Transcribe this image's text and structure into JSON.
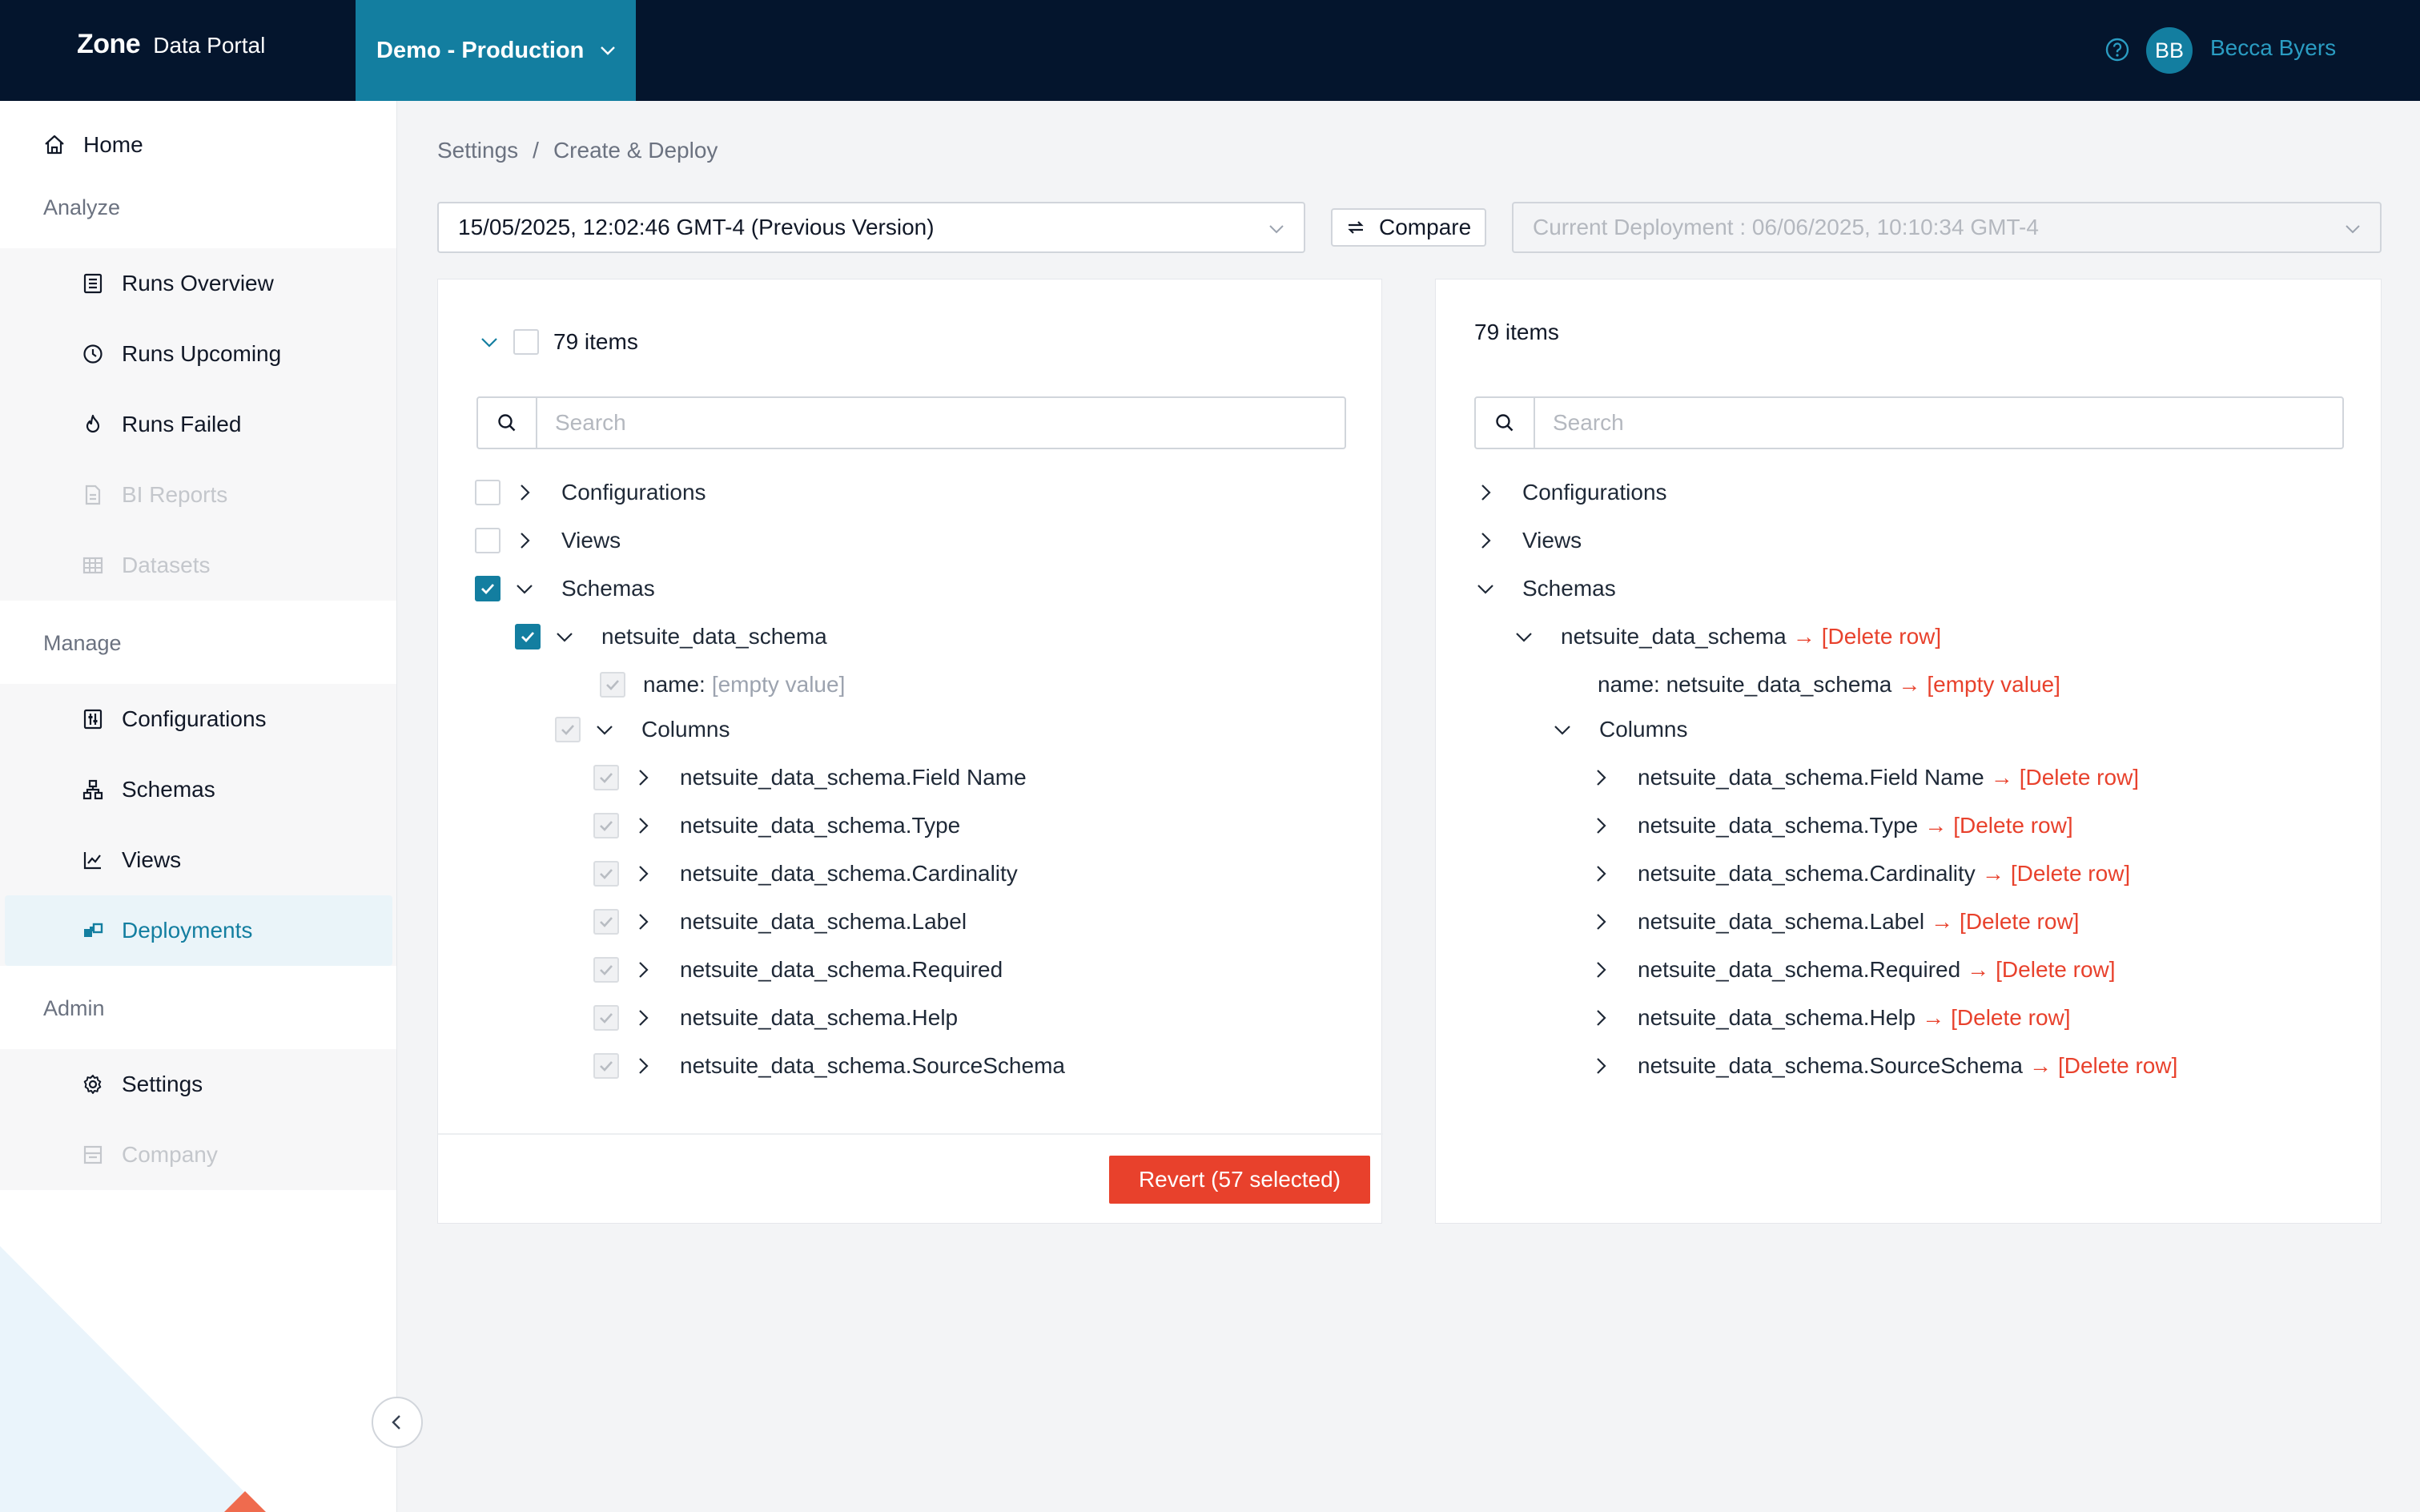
{
  "header": {
    "brand": "Zone",
    "product": "Data Portal",
    "environment": "Demo - Production",
    "user_initials": "BB",
    "user_name": "Becca Byers"
  },
  "sidebar": {
    "home": "Home",
    "sections": {
      "analyze": "Analyze",
      "manage": "Manage",
      "admin": "Admin"
    },
    "analyze_items": [
      "Runs Overview",
      "Runs Upcoming",
      "Runs Failed",
      "BI Reports",
      "Datasets"
    ],
    "manage_items": [
      "Configurations",
      "Schemas",
      "Views",
      "Deployments"
    ],
    "admin_items": [
      "Settings",
      "Company"
    ],
    "active": "Deployments"
  },
  "breadcrumb": {
    "parent": "Settings",
    "separator": "/",
    "current": "Create & Deploy"
  },
  "toolbar": {
    "version_value": "15/05/2025, 12:02:46 GMT-4 (Previous Version)",
    "compare_label": "Compare",
    "current_deployment": "Current Deployment : 06/06/2025, 10:10:34 GMT-4"
  },
  "left_panel": {
    "count_label": "79 items",
    "search_placeholder": "Search",
    "tree": {
      "configurations": "Configurations",
      "views": "Views",
      "schemas": "Schemas",
      "schema_name": "netsuite_data_schema",
      "name_key": "name:",
      "name_value": "[empty value]",
      "columns": "Columns",
      "column_items": [
        "netsuite_data_schema.Field Name",
        "netsuite_data_schema.Type",
        "netsuite_data_schema.Cardinality",
        "netsuite_data_schema.Label",
        "netsuite_data_schema.Required",
        "netsuite_data_schema.Help",
        "netsuite_data_schema.SourceSchema"
      ]
    },
    "revert_label": "Revert (57 selected)"
  },
  "right_panel": {
    "count_label": "79 items",
    "search_placeholder": "Search",
    "tree": {
      "configurations": "Configurations",
      "views": "Views",
      "schemas": "Schemas",
      "schema_name": "netsuite_data_schema",
      "schema_change": "[Delete row]",
      "name_label": "name: netsuite_data_schema",
      "name_change": "[empty value]",
      "columns": "Columns",
      "column_items": [
        "netsuite_data_schema.Field Name",
        "netsuite_data_schema.Type",
        "netsuite_data_schema.Cardinality",
        "netsuite_data_schema.Label",
        "netsuite_data_schema.Required",
        "netsuite_data_schema.Help",
        "netsuite_data_schema.SourceSchema"
      ],
      "column_change": "[Delete row]"
    }
  },
  "colors": {
    "topbar": "#04152d",
    "accent": "#137ea0",
    "danger": "#e8412c"
  }
}
